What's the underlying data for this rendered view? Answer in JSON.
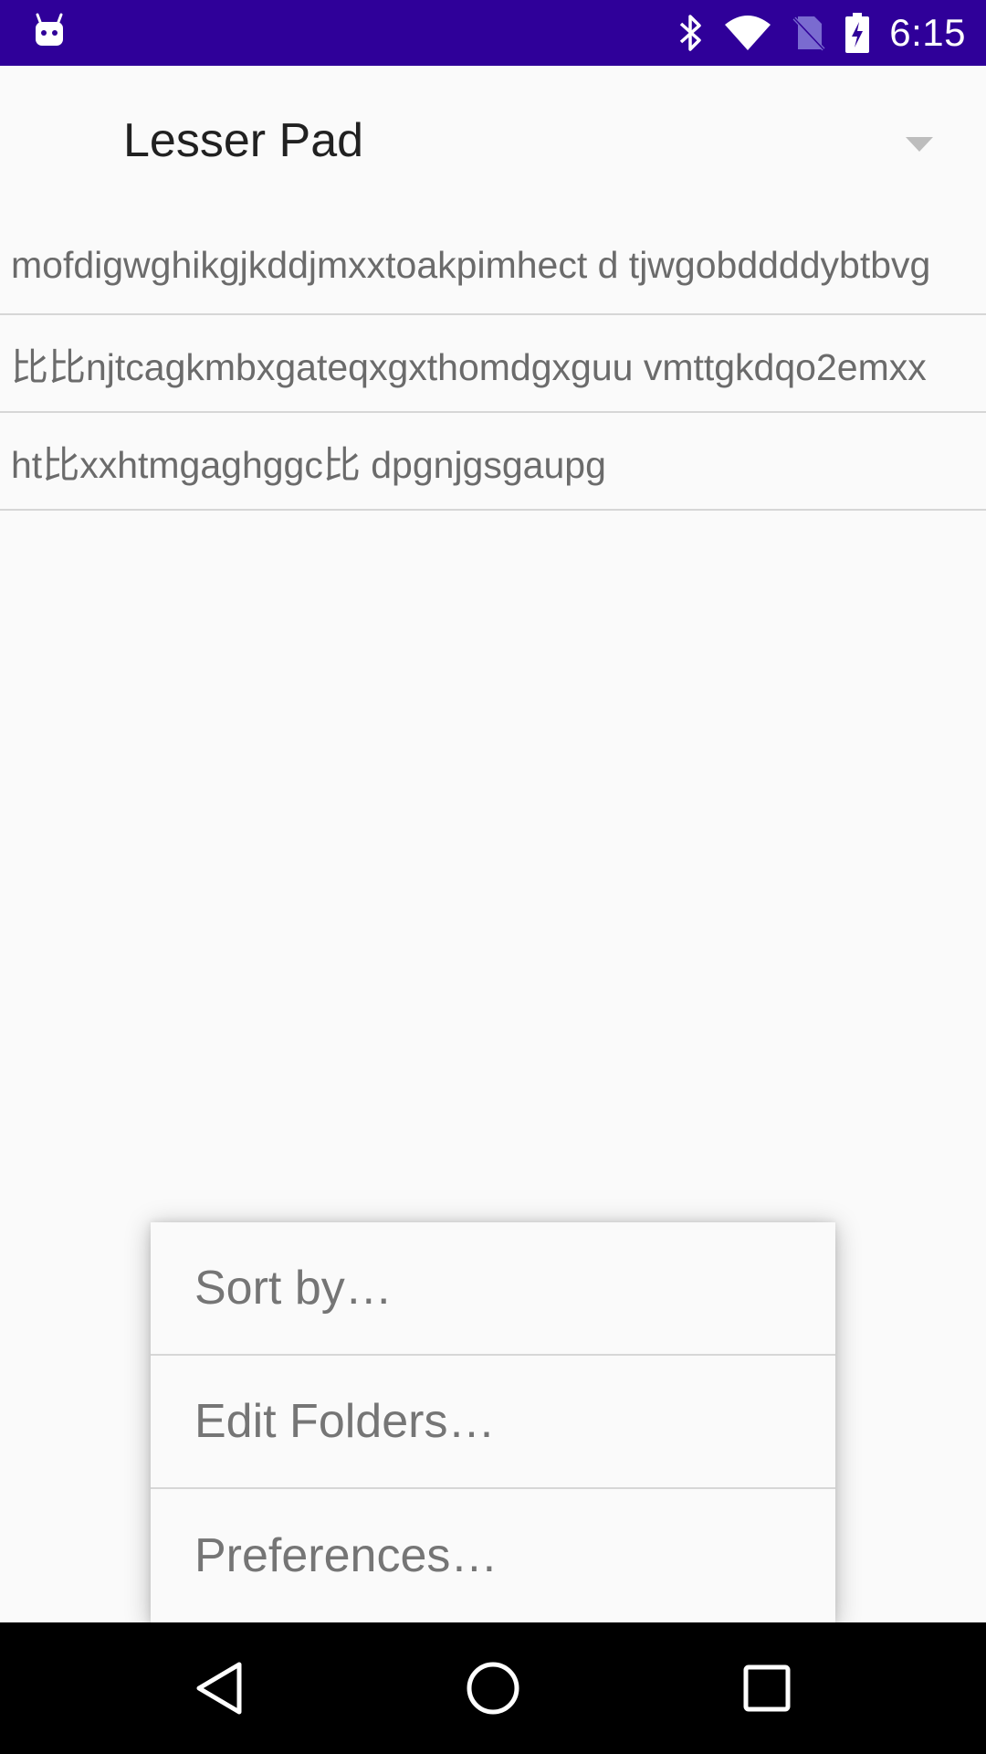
{
  "status_bar": {
    "time": "6:15",
    "background_color": "#2f0099",
    "icons": [
      "debug-app-icon",
      "bluetooth-icon",
      "wifi-icon",
      "no-sim-icon",
      "battery-charging-icon"
    ]
  },
  "app_bar": {
    "folder_title": "Lesser Pad",
    "dropdown_icon": "triangle-down-icon"
  },
  "notes": [
    {
      "text": "mofdigwghikgjkddjmxxtoakpimhect d tjwgobddddybtbvg"
    },
    {
      "text": "比比njtcagkmbxgateqxgxthomdgxguu vmttgkdqo2emxx"
    },
    {
      "text": "ht比xxhtmgaghggc比 dpgnjgsgaupg"
    }
  ],
  "menu": {
    "items": [
      {
        "label": "Sort by…"
      },
      {
        "label": "Edit Folders…"
      },
      {
        "label": "Preferences…"
      }
    ]
  },
  "nav_bar": {
    "icons": [
      "back-icon",
      "home-icon",
      "recents-icon"
    ]
  }
}
